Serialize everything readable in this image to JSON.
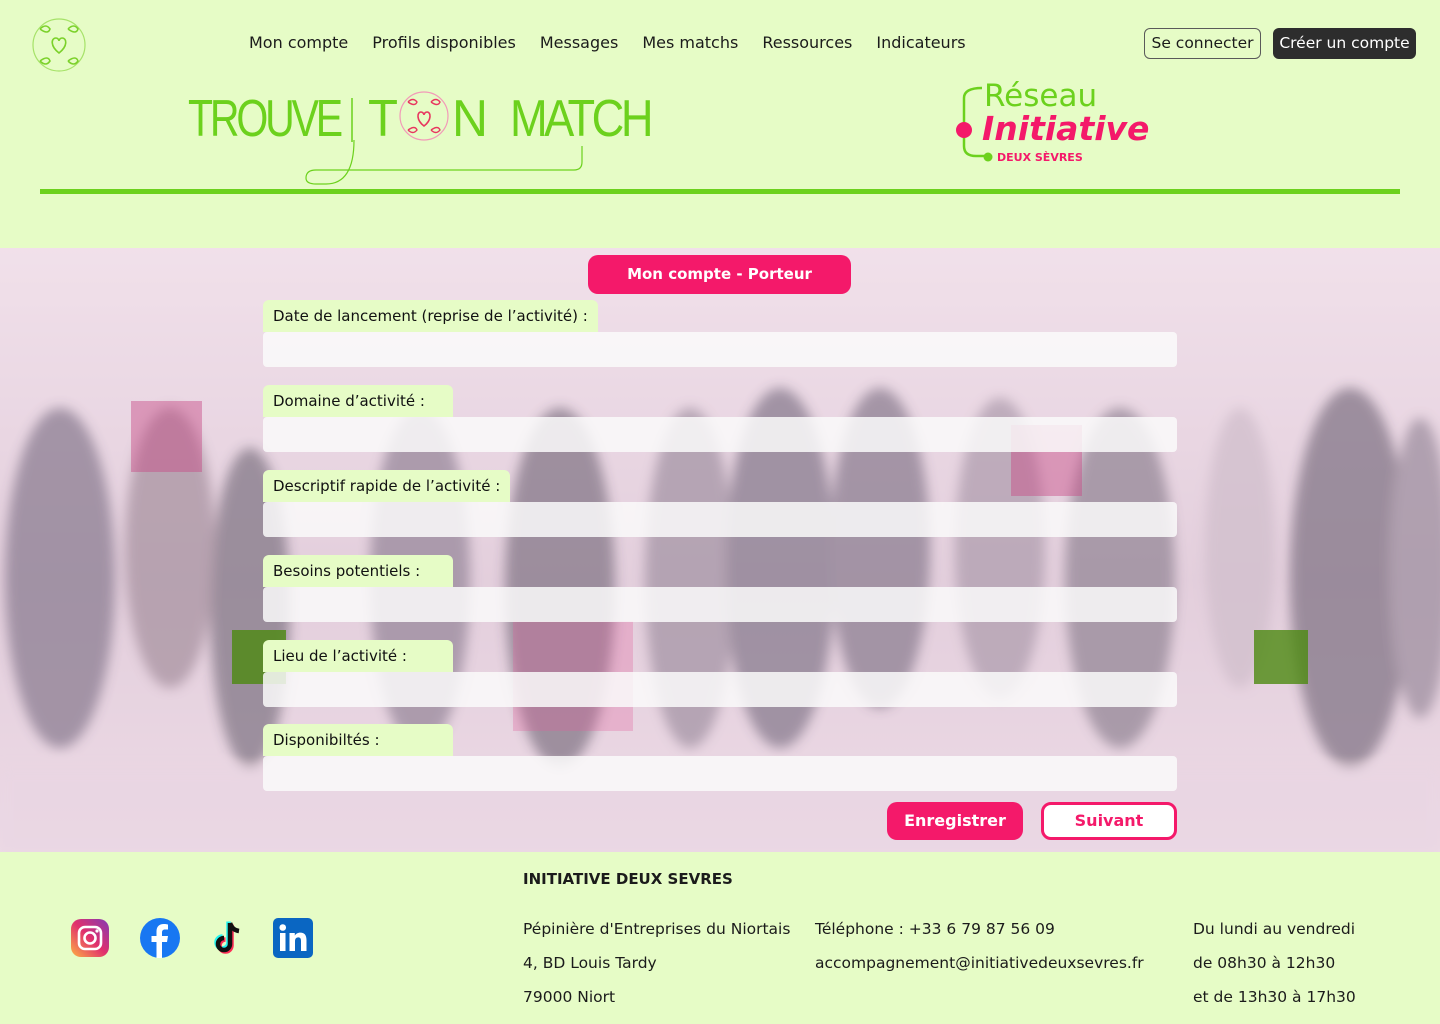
{
  "nav": {
    "items": [
      {
        "label": "Mon compte"
      },
      {
        "label": "Profils disponibles"
      },
      {
        "label": "Messages"
      },
      {
        "label": "Mes matchs"
      },
      {
        "label": "Ressources"
      },
      {
        "label": "Indicateurs"
      }
    ],
    "login_label": "Se connecter",
    "signup_label": "Créer un compte"
  },
  "brand": {
    "logo_text_1": "TROUVE",
    "logo_text_2": "T",
    "logo_text_3": "N",
    "logo_text_4": "MATCH"
  },
  "partner": {
    "line1": "Réseau",
    "line2": "Initiative",
    "line3": "DEUX SÈVRES"
  },
  "form": {
    "title": "Mon compte - Porteur",
    "fields": [
      {
        "label": "Date de lancement (reprise de l’activité) :",
        "value": ""
      },
      {
        "label": "Domaine d’activité :",
        "value": ""
      },
      {
        "label": "Descriptif rapide de l’activité :",
        "value": ""
      },
      {
        "label": "Besoins potentiels :",
        "value": ""
      },
      {
        "label": "Lieu de l’activité :",
        "value": ""
      },
      {
        "label": "Disponibiltés :",
        "value": ""
      }
    ],
    "save_label": "Enregistrer",
    "next_label": "Suivant"
  },
  "footer": {
    "org_name": "INITIATIVE DEUX SEVRES",
    "address": [
      "Pépinière d'Entreprises du Niortais",
      "4, BD Louis Tardy",
      "79000 Niort"
    ],
    "phone": "Téléphone : +33 6 79 87 56 09",
    "email": "accompagnement@initiativedeuxsevres.fr",
    "hours": [
      "Du lundi au vendredi",
      "de 08h30 à 12h30",
      "et de 13h30 à 17h30"
    ],
    "social": [
      "instagram-icon",
      "facebook-icon",
      "tiktok-icon",
      "linkedin-icon"
    ]
  },
  "colors": {
    "background": "#e6fcc6",
    "accent_green": "#6cd11d",
    "accent_pink": "#f4196a",
    "dark_button": "#2d2d2d"
  }
}
